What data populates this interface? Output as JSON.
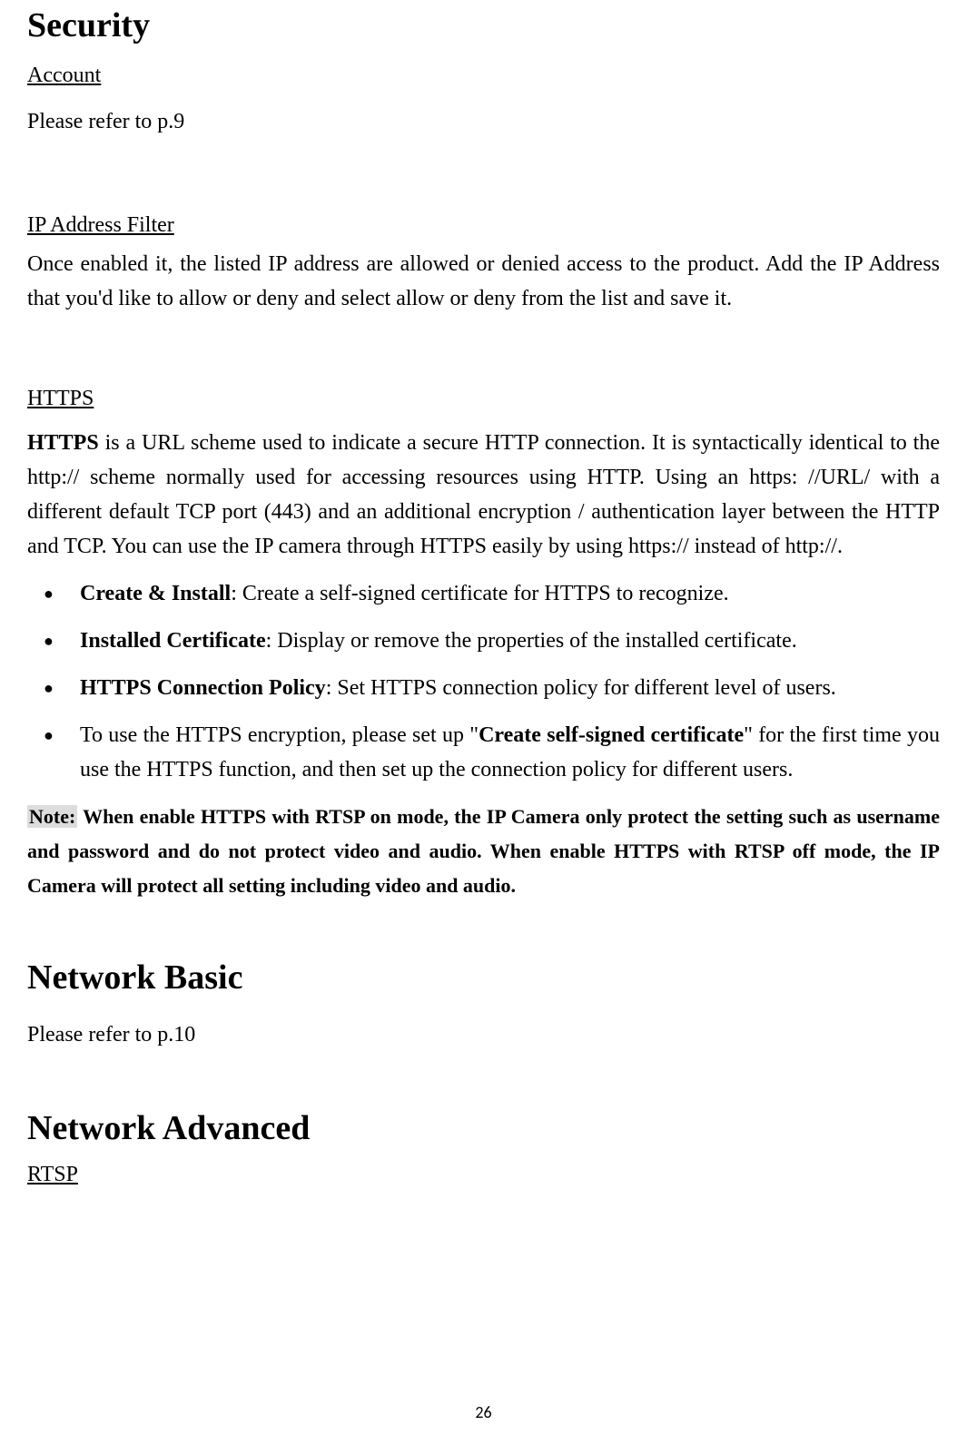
{
  "security": {
    "heading": "Security",
    "account": {
      "title": "Account",
      "text": "Please refer to p.9"
    },
    "ip_filter": {
      "title": "IP Address Filter",
      "text": "Once enabled it, the listed IP address are allowed or denied access to the product. Add the IP Address that you'd like to allow or deny and select allow or deny from the list and save it."
    },
    "https": {
      "title": "HTTPS",
      "intro_strong": "HTTPS",
      "intro_rest": " is a URL scheme used to indicate a secure HTTP connection. It is syntactically identical to the http:// scheme normally used for accessing resources using HTTP. Using an https: //URL/ with a different default TCP port (443) and an additional encryption / authentication layer between the HTTP and TCP. You can use the IP camera through HTTPS easily by using https:// instead of http://.",
      "bullets": {
        "b1_strong": "Create & Install",
        "b1_rest": ": Create a self-signed certificate for HTTPS to recognize.",
        "b2_strong": "Installed Certificate",
        "b2_rest": ": Display or remove the properties of the installed certificate.",
        "b3_strong": "HTTPS Connection Policy",
        "b3_rest": ": Set HTTPS connection policy for different level of users.",
        "b4_pre": "To use the HTTPS encryption, please set up \"",
        "b4_strong": "Create self-signed certificate",
        "b4_post": "\" for the first time you use the HTTPS function, and then set up the connection policy for different users."
      },
      "note_label": "Note:",
      "note_rest": " When enable HTTPS with RTSP on mode, the IP Camera only protect the setting such as username and password and do not protect video and audio. When enable HTTPS with RTSP off mode, the IP Camera will protect all setting including video and audio."
    }
  },
  "network_basic": {
    "heading": "Network Basic",
    "text": "Please refer to p.10"
  },
  "network_advanced": {
    "heading": "Network Advanced",
    "rtsp_title": "RTSP"
  },
  "page_number": "26"
}
